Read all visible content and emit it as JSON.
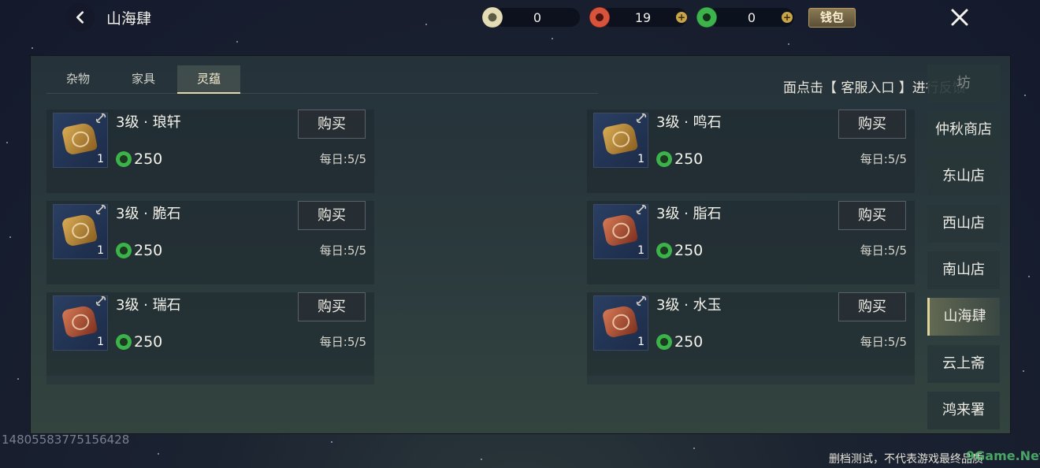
{
  "header": {
    "title": "山海肆",
    "currencies": [
      {
        "icon": "jade-ring-icon",
        "value": "0",
        "color": "#d9d0a8"
      },
      {
        "icon": "red-spiral-coin-icon",
        "value": "19",
        "color": "#c7432f"
      },
      {
        "icon": "green-spiral-coin-icon",
        "value": "0",
        "color": "#37a648"
      }
    ],
    "wallet_label": "钱包"
  },
  "tabs": [
    {
      "label": "杂物",
      "active": false
    },
    {
      "label": "家具",
      "active": false
    },
    {
      "label": "灵蕴",
      "active": true
    }
  ],
  "notice": "面点击【 客服入口 】进行反馈",
  "items": [
    {
      "name": "3级 · 琅轩",
      "qty": "1",
      "price": "250",
      "buy_label": "购买",
      "limit": "每日:5/5",
      "color": "#b8893a"
    },
    {
      "name": "3级 · 鸣石",
      "qty": "1",
      "price": "250",
      "buy_label": "购买",
      "limit": "每日:5/5",
      "color": "#b8893a"
    },
    {
      "name": "3级 · 脆石",
      "qty": "1",
      "price": "250",
      "buy_label": "购买",
      "limit": "每日:5/5",
      "color": "#b8893a"
    },
    {
      "name": "3级 · 脂石",
      "qty": "1",
      "price": "250",
      "buy_label": "购买",
      "limit": "每日:5/5",
      "color": "#b4553a"
    },
    {
      "name": "3级 · 瑞石",
      "qty": "1",
      "price": "250",
      "buy_label": "购买",
      "limit": "每日:5/5",
      "color": "#b4553a"
    },
    {
      "name": "3级 · 水玉",
      "qty": "1",
      "price": "250",
      "buy_label": "购买",
      "limit": "每日:5/5",
      "color": "#b4553a"
    }
  ],
  "sidenav": [
    {
      "label": "坊",
      "active": false
    },
    {
      "label": "仲秋商店",
      "active": false
    },
    {
      "label": "东山店",
      "active": false
    },
    {
      "label": "西山店",
      "active": false
    },
    {
      "label": "南山店",
      "active": false
    },
    {
      "label": "山海肆",
      "active": true
    },
    {
      "label": "云上斋",
      "active": false
    },
    {
      "label": "鸿来署",
      "active": false
    }
  ],
  "uid": "1480558377515642​8",
  "disclaimer": "删档测试，不代表游戏最终品质",
  "watermark": "9Game.Net"
}
